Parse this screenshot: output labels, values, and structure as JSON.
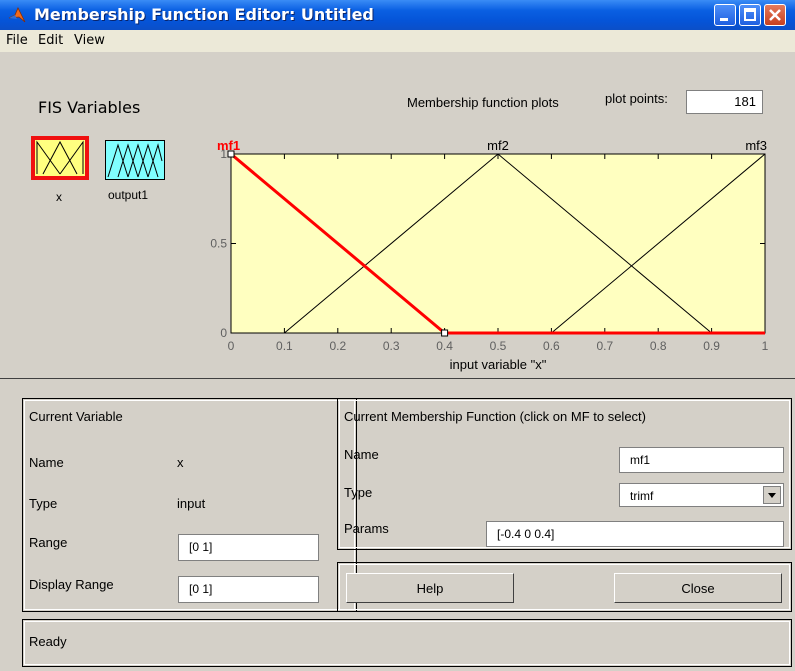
{
  "window": {
    "title": "Membership Function Editor: Untitled"
  },
  "menu": {
    "file": "File",
    "edit": "Edit",
    "view": "View"
  },
  "fis_vars": {
    "heading": "FIS Variables",
    "input_label": "x",
    "output_label": "output1"
  },
  "plot": {
    "heading": "Membership function plots",
    "plot_points_label": "plot points:",
    "plot_points_value": "181",
    "xlabel": "input variable \"x\"",
    "mf_labels": [
      "mf1",
      "mf2",
      "mf3"
    ],
    "x_ticks": [
      "0",
      "0.1",
      "0.2",
      "0.3",
      "0.4",
      "0.5",
      "0.6",
      "0.7",
      "0.8",
      "0.9",
      "1"
    ],
    "y_ticks": [
      "0",
      "0.5",
      "1"
    ]
  },
  "chart_data": {
    "type": "line",
    "xlabel": "input variable \"x\"",
    "xlim": [
      0,
      1
    ],
    "ylim": [
      0,
      1
    ],
    "series": [
      {
        "name": "mf1",
        "x": [
          0,
          0,
          0.4,
          1
        ],
        "y": [
          1,
          1,
          0,
          0
        ],
        "selected": true
      },
      {
        "name": "mf2",
        "x": [
          0,
          0.1,
          0.5,
          0.9,
          1
        ],
        "y": [
          0,
          0,
          1,
          0,
          0
        ]
      },
      {
        "name": "mf3",
        "x": [
          0,
          0.6,
          1,
          1
        ],
        "y": [
          0,
          0,
          1,
          1
        ]
      }
    ],
    "colors": {
      "background": "#ffffc0",
      "selected": "#ff0000",
      "normal": "#000000"
    }
  },
  "current_variable": {
    "heading": "Current Variable",
    "name_label": "Name",
    "name_value": "x",
    "type_label": "Type",
    "type_value": "input",
    "range_label": "Range",
    "range_value": "[0 1]",
    "display_range_label": "Display Range",
    "display_range_value": "[0 1]"
  },
  "current_mf": {
    "heading": "Current Membership Function (click on MF to select)",
    "name_label": "Name",
    "name_value": "mf1",
    "type_label": "Type",
    "type_value": "trimf",
    "params_label": "Params",
    "params_value": "[-0.4 0 0.4]"
  },
  "buttons": {
    "help": "Help",
    "close": "Close"
  },
  "status": {
    "text": "Ready"
  }
}
